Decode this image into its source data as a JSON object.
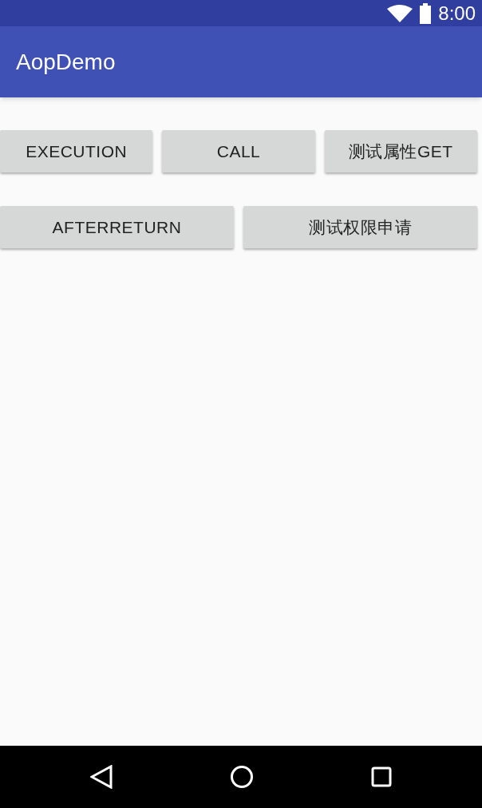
{
  "status_bar": {
    "time": "8:00"
  },
  "app_bar": {
    "title": "AopDemo"
  },
  "button_rows": [
    {
      "buttons": [
        "EXECUTION",
        "CALL",
        "测试属性GET"
      ]
    },
    {
      "buttons": [
        "AFTERRETURN",
        "测试权限申请"
      ]
    }
  ]
}
